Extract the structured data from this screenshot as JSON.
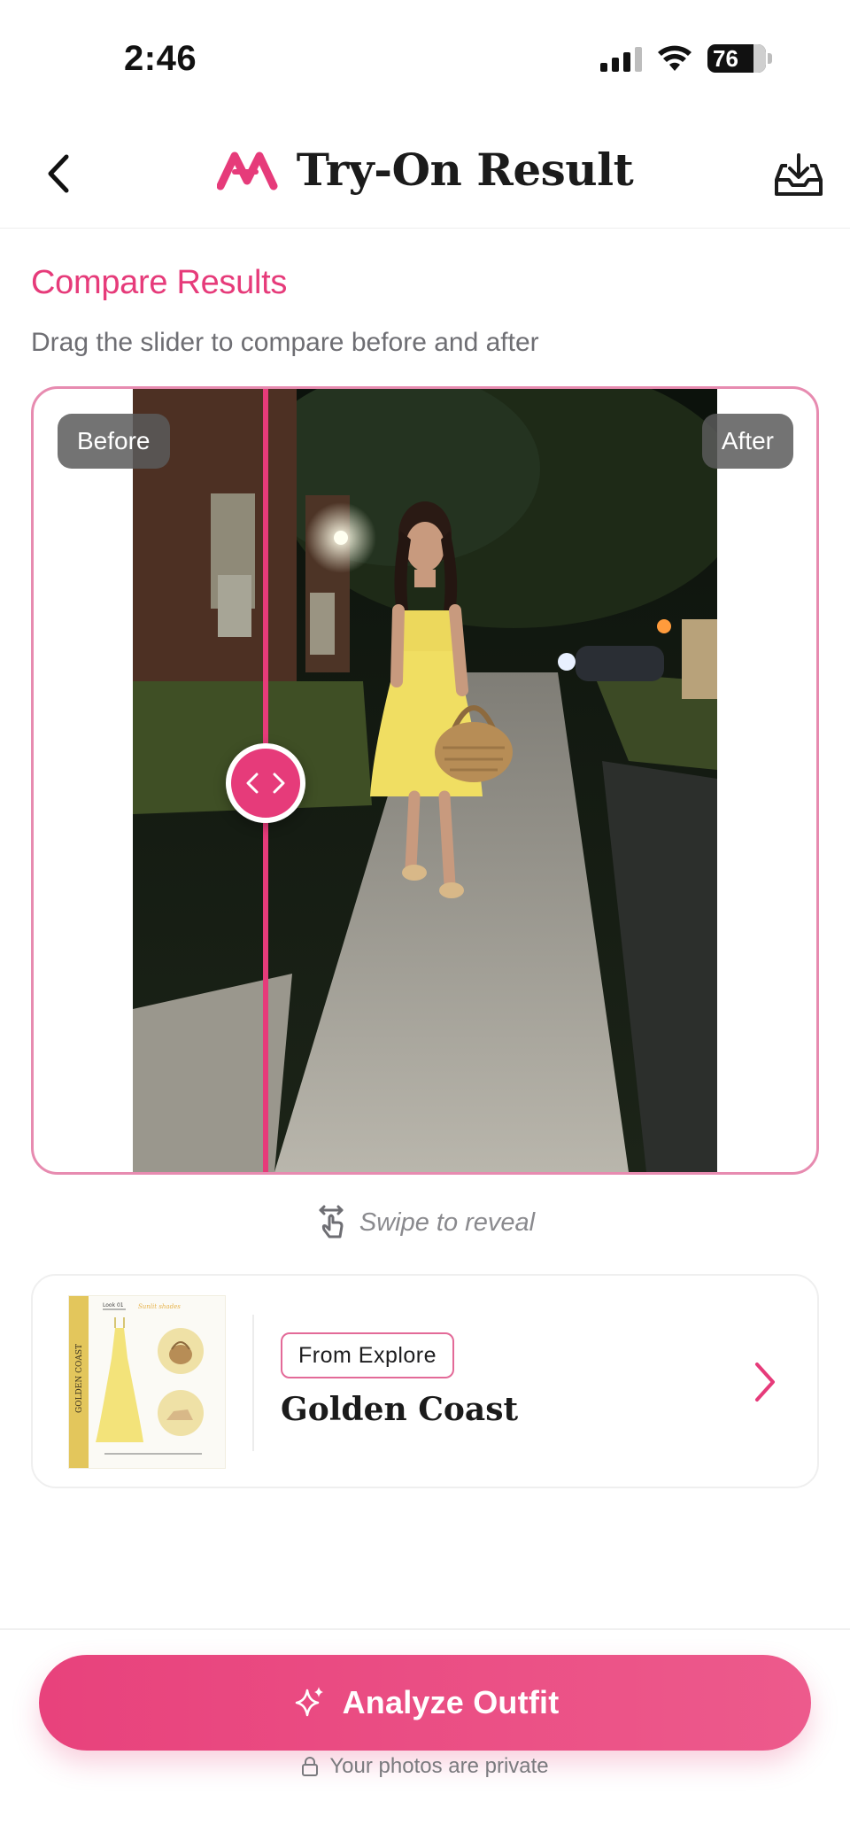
{
  "status_bar": {
    "time": "2:46",
    "battery": "76"
  },
  "header": {
    "title": "Try-On Result"
  },
  "compare": {
    "title": "Compare Results",
    "subtitle": "Drag the slider to compare before and after",
    "before_label": "Before",
    "after_label": "After",
    "slider_position": 0.39,
    "hint": "Swipe to reveal"
  },
  "outfit": {
    "badge": "From Explore",
    "name": "Golden Coast",
    "thumb_title": "GOLDEN COAST",
    "thumb_look": "Look 01",
    "thumb_note": "Sunlit shades"
  },
  "actions": {
    "analyze_label": "Analyze Outfit",
    "privacy_text": "Your photos are private"
  },
  "colors": {
    "accent": "#e63b7a",
    "card_border": "#e78bb0"
  }
}
